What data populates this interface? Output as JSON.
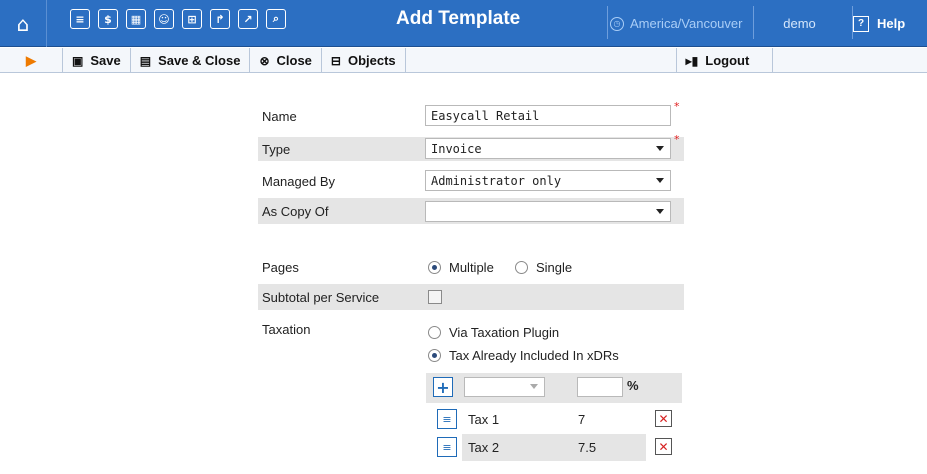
{
  "header": {
    "title": "Add Template",
    "timezone": "America/Vancouver",
    "user": "demo",
    "help_label": "Help",
    "icons": [
      "home-icon",
      "list-icon",
      "dollar-icon",
      "grid-icon",
      "person-icon",
      "modules-icon",
      "export-icon",
      "chart-icon",
      "search-icon"
    ]
  },
  "toolbar": {
    "save_label": "Save",
    "save_close_label": "Save & Close",
    "close_label": "Close",
    "objects_label": "Objects",
    "logout_label": "Logout"
  },
  "form": {
    "name_label": "Name",
    "name_value": "Easycall Retail",
    "type_label": "Type",
    "type_value": "Invoice",
    "managed_by_label": "Managed By",
    "managed_by_value": "Administrator only",
    "as_copy_of_label": "As Copy Of",
    "as_copy_of_value": "",
    "pages_label": "Pages",
    "pages_options": [
      "Multiple",
      "Single"
    ],
    "pages_selected": "Multiple",
    "subtotal_label": "Subtotal per Service",
    "subtotal_checked": false,
    "taxation_label": "Taxation",
    "taxation_options": [
      "Via Taxation Plugin",
      "Tax Already Included In xDRs"
    ],
    "taxation_selected": "Tax Already Included In xDRs",
    "percent_sign": "%",
    "taxes": [
      {
        "name": "Tax 1",
        "rate": "7"
      },
      {
        "name": "Tax 2",
        "rate": "7.5"
      }
    ]
  },
  "colors": {
    "header_bg": "#2c6fc2",
    "accent": "#ee7a00",
    "required": "#e02020"
  }
}
